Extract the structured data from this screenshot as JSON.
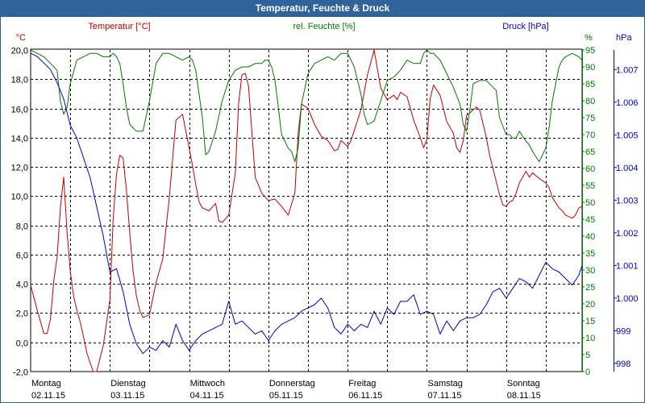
{
  "window": {
    "title": "Temperatur, Feuchte & Druck"
  },
  "chart_data": {
    "type": "line",
    "title": "Temperatur, Feuchte & Druck",
    "colors": {
      "temperature": "#c00000",
      "humidity": "#007a00",
      "pressure": "#0000c8",
      "grid": "#000000"
    },
    "grid": true,
    "x_ticks": [
      {
        "day": "Montag",
        "date": "02.11.15",
        "t": 0
      },
      {
        "day": "Dienstag",
        "date": "03.11.15",
        "t": 24
      },
      {
        "day": "Mittwoch",
        "date": "04.11.15",
        "t": 48
      },
      {
        "day": "Donnerstag",
        "date": "05.11.15",
        "t": 72
      },
      {
        "day": "Freitag",
        "date": "06.11.15",
        "t": 96
      },
      {
        "day": "Samstag",
        "date": "07.11.15",
        "t": 120
      },
      {
        "day": "Sonntag",
        "date": "08.11.15",
        "t": 144
      }
    ],
    "xlim": [
      0,
      167
    ],
    "axes": {
      "left": {
        "label": "Temperatur [°C]",
        "unit": "°C",
        "ylim": [
          -2,
          20
        ],
        "ticks": [
          "20,0",
          "18,0",
          "16,0",
          "14,0",
          "12,0",
          "10,0",
          "8,0",
          "6,0",
          "4,0",
          "2,0",
          "0,0",
          "-2,0"
        ],
        "tick_values": [
          20,
          18,
          16,
          14,
          12,
          10,
          8,
          6,
          4,
          2,
          0,
          -2
        ]
      },
      "right1": {
        "label": "rel. Feuchte [%]",
        "unit": "%",
        "ylim": [
          0,
          95
        ],
        "ticks": [
          "95",
          "90",
          "85",
          "80",
          "75",
          "70",
          "65",
          "60",
          "55",
          "50",
          "45",
          "40",
          "35",
          "30",
          "25",
          "20",
          "15",
          "10",
          "5",
          "0"
        ],
        "tick_values": [
          95,
          90,
          85,
          80,
          75,
          70,
          65,
          60,
          55,
          50,
          45,
          40,
          35,
          30,
          25,
          20,
          15,
          10,
          5,
          0
        ]
      },
      "right2": {
        "label": "Druck [hPa]",
        "unit": "hPa",
        "ylim": [
          997.75,
          1007.6
        ],
        "ticks": [
          "1.007",
          "1.006",
          "1.005",
          "1.004",
          "1.003",
          "1.002",
          "1.001",
          "1.000",
          "999",
          "998"
        ],
        "tick_values": [
          1007,
          1006,
          1005,
          1004,
          1003,
          1002,
          1001,
          1000,
          999,
          998
        ]
      }
    },
    "series": [
      {
        "name": "Temperatur [°C]",
        "axis": "left",
        "x": [
          0,
          2,
          4,
          5,
          6,
          7,
          8,
          9,
          10,
          11,
          12,
          13,
          14,
          15,
          16,
          17,
          18,
          19,
          20,
          22,
          24,
          25,
          26,
          27,
          28,
          29,
          30,
          31,
          32,
          33,
          34,
          36,
          38,
          40,
          42,
          44,
          46,
          48,
          49,
          50,
          51,
          52,
          54,
          56,
          57,
          58,
          60,
          62,
          63,
          64,
          65,
          66,
          68,
          70,
          72,
          74,
          76,
          78,
          80,
          81,
          82,
          84,
          86,
          88,
          90,
          92,
          93,
          94,
          96,
          97,
          98,
          100,
          102,
          104,
          105,
          106,
          108,
          110,
          111,
          112,
          114,
          116,
          118,
          119,
          120,
          121,
          122,
          124,
          126,
          128,
          129,
          130,
          131,
          132,
          134,
          135,
          136,
          138,
          139,
          140,
          142,
          143,
          144,
          145,
          146,
          147,
          148,
          150,
          151,
          152,
          154,
          156,
          157,
          158,
          160,
          161,
          162,
          164,
          165,
          166,
          167
        ],
        "y": [
          3.9,
          2.2,
          0.6,
          0.6,
          1.6,
          4.2,
          5.8,
          9.2,
          11.3,
          7.6,
          4.9,
          3.2,
          2.2,
          1.4,
          0.4,
          -0.7,
          -1.4,
          -2.0,
          -2.0,
          -0.2,
          2.9,
          8.5,
          11.5,
          12.8,
          12.6,
          10.4,
          7.5,
          4.9,
          3.2,
          2.2,
          1.7,
          1.9,
          4.1,
          5.7,
          9.9,
          15.2,
          15.6,
          13.3,
          12.1,
          10.8,
          9.6,
          9.2,
          9.0,
          9.5,
          8.3,
          8.2,
          8.7,
          11.6,
          16.4,
          18.3,
          18.4,
          17.5,
          11.3,
          10.2,
          9.7,
          9.8,
          9.3,
          8.7,
          10.2,
          14.3,
          16.3,
          16.0,
          14.9,
          14.1,
          13.8,
          13.1,
          13.2,
          13.8,
          13.4,
          13.8,
          14.5,
          15.9,
          18.3,
          20.0,
          18.7,
          17.4,
          16.6,
          16.9,
          16.6,
          17.1,
          16.8,
          15.2,
          14.0,
          13.3,
          13.9,
          16.7,
          17.6,
          16.9,
          15.1,
          14.3,
          13.3,
          13.0,
          13.8,
          15.5,
          15.9,
          16.1,
          15.9,
          14.0,
          12.8,
          11.9,
          10.1,
          9.4,
          9.3,
          9.6,
          9.7,
          10.2,
          10.9,
          11.7,
          11.3,
          11.6,
          11.2,
          10.9,
          10.6,
          9.9,
          9.2,
          9.0,
          8.7,
          8.5,
          8.7,
          9.2,
          9.3
        ]
      },
      {
        "name": "rel. Feuchte [%]",
        "axis": "right1",
        "x": [
          0,
          2,
          4,
          6,
          8,
          9,
          10,
          11,
          12,
          14,
          16,
          18,
          20,
          22,
          24,
          25,
          26,
          27,
          28,
          29,
          30,
          32,
          34,
          36,
          38,
          40,
          42,
          44,
          46,
          48,
          49,
          50,
          51,
          52,
          53,
          54,
          56,
          58,
          60,
          62,
          64,
          66,
          68,
          70,
          71,
          72,
          73,
          74,
          76,
          78,
          79,
          80,
          81,
          82,
          84,
          86,
          88,
          90,
          92,
          94,
          96,
          98,
          100,
          101,
          102,
          104,
          106,
          108,
          110,
          111,
          112,
          114,
          116,
          118,
          119,
          120,
          121,
          122,
          124,
          126,
          128,
          130,
          131,
          132,
          133,
          134,
          136,
          138,
          140,
          141,
          142,
          144,
          145,
          146,
          147,
          148,
          150,
          151,
          152,
          154,
          156,
          157,
          158,
          160,
          161,
          162,
          164,
          166,
          167
        ],
        "y": [
          95,
          94,
          93,
          91,
          89,
          80,
          76,
          78,
          85,
          92,
          93,
          94,
          94,
          93,
          93,
          94,
          93,
          91,
          85,
          78,
          73,
          71,
          71,
          80,
          91,
          94,
          94,
          93,
          92,
          93,
          92,
          89,
          82,
          75,
          64,
          65,
          71,
          80,
          86,
          89,
          90,
          90,
          91,
          91,
          92,
          92,
          90,
          86,
          70,
          66,
          65,
          62,
          66,
          79,
          88,
          91,
          92,
          93,
          92,
          94,
          94,
          90,
          82,
          76,
          73,
          74,
          80,
          86,
          87,
          88,
          89,
          92,
          91,
          91,
          94,
          95,
          94,
          94,
          92,
          88,
          84,
          79,
          73,
          71,
          77,
          85,
          86,
          86,
          84,
          83,
          75,
          70,
          70,
          69,
          69,
          71,
          68,
          67,
          65,
          62,
          66,
          72,
          80,
          90,
          92,
          93,
          94,
          93,
          92
        ]
      },
      {
        "name": "Druck [hPa]",
        "axis": "right2",
        "x": [
          0,
          2,
          4,
          6,
          8,
          10,
          12,
          14,
          16,
          18,
          20,
          22,
          24,
          26,
          28,
          30,
          32,
          34,
          36,
          38,
          40,
          42,
          44,
          46,
          48,
          50,
          52,
          54,
          56,
          58,
          60,
          62,
          64,
          66,
          68,
          70,
          72,
          74,
          76,
          78,
          80,
          82,
          84,
          86,
          88,
          90,
          92,
          94,
          96,
          98,
          100,
          102,
          104,
          106,
          108,
          110,
          112,
          114,
          116,
          118,
          120,
          122,
          124,
          126,
          128,
          130,
          132,
          134,
          136,
          138,
          140,
          142,
          144,
          146,
          148,
          150,
          152,
          154,
          156,
          158,
          160,
          162,
          164,
          166,
          167
        ],
        "y": [
          1007.5,
          1007.4,
          1007.2,
          1007.0,
          1006.6,
          1006.1,
          1005.3,
          1004.9,
          1004.3,
          1003.7,
          1002.8,
          1001.9,
          1000.8,
          1000.9,
          1000.2,
          999.2,
          998.6,
          998.3,
          998.5,
          998.4,
          998.7,
          998.5,
          999.2,
          998.7,
          998.4,
          998.7,
          998.9,
          999.0,
          999.1,
          999.2,
          999.9,
          999.2,
          999.3,
          999.1,
          998.9,
          999.0,
          998.7,
          999.0,
          999.2,
          999.3,
          999.4,
          999.6,
          999.7,
          999.8,
          1000.0,
          999.7,
          999.1,
          998.9,
          999.2,
          999.0,
          999.2,
          999.1,
          999.6,
          999.2,
          999.7,
          999.5,
          999.9,
          999.9,
          1000.1,
          999.5,
          999.6,
          999.5,
          998.9,
          999.3,
          999.0,
          999.3,
          999.4,
          999.4,
          999.5,
          999.8,
          1000.2,
          1000.3,
          1000.0,
          1000.3,
          1000.6,
          1000.5,
          1000.3,
          1000.7,
          1001.1,
          1000.9,
          1000.8,
          1000.6,
          1000.4,
          1000.7,
          1001.0
        ]
      }
    ]
  }
}
